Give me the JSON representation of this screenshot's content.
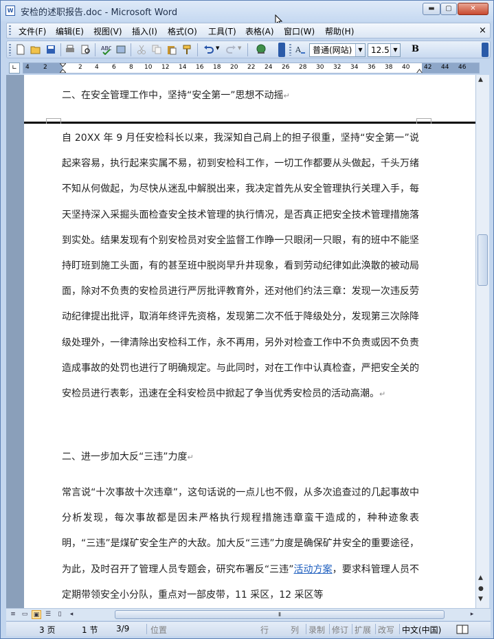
{
  "window": {
    "title": "安检的述职报告.doc - Microsoft Word",
    "app_icon_text": "W",
    "min_glyph": "▬",
    "max_glyph": "▢",
    "close_glyph": "✕"
  },
  "menu": {
    "items": [
      "文件(F)",
      "编辑(E)",
      "视图(V)",
      "插入(I)",
      "格式(O)",
      "工具(T)",
      "表格(A)",
      "窗口(W)",
      "帮助(H)"
    ],
    "close_glyph": "×"
  },
  "toolbar": {
    "style_value": "普通(网站)",
    "size_value": "12.5",
    "bold_label": "B"
  },
  "ruler": {
    "corner_glyph": "∟",
    "labels": [
      "4",
      "2",
      "2",
      "4",
      "6",
      "8",
      "10",
      "12",
      "14",
      "16",
      "18",
      "20",
      "22",
      "24",
      "26",
      "28",
      "30",
      "32",
      "34",
      "36",
      "38",
      "40",
      "42",
      "44",
      "46"
    ]
  },
  "document": {
    "heading1": "二、在安全管理工作中，坚持“安全第一”思想不动摇",
    "para1": "自 20XX 年 9 月任安检科长以来，我深知自己肩上的担子很重，坚持“安全第一”说起来容易，执行起来实属不易，初到安检科工作，一切工作都要从头做起，千头万绪不知从何做起，为尽快从迷乱中解脱出来，我决定首先从安全管理执行关理入手，每天坚持深入采掘头面检查安全技术管理的执行情况，是否真正把安全技术管理措施落到实处。结果发现有个别安检员对安全监督工作睁一只眼闭一只眼，有的班中不能坚持盯班到施工头面，有的甚至班中脱岗早升井现象，看到劳动纪律如此涣散的被动局面，除对不负责的安检员进行严厉批评教育外，还对他们约法三章：发现一次违反劳动纪律提出批评，取消年终评先资格，发现第二次不低于降级处分，发现第三次除降级处理外，一律清除出安检科工作，永不再用，另外对检查工作中不负责或因不负责造成事故的处罚也进行了明确规定。与此同时，对在工作中认真检查，严把安全关的安检员进行表彰，迅速在全科安检员中掀起了争当优秀安检员的活动高潮。",
    "heading2": "二、进一步加大反“三违”力度",
    "para2_start": "常言说“十次事故十次违章”，这句话说的一点儿也不假，从多次追查过的几起事故中分析发现，每次事故都是因未严格执行规程措施违章蛮干造成的，种种迹象表明，“三违”是煤矿安全生产的大敌。加大反“三违”力度是确保矿井安全的重要途径，为此，及时召开了管理人员专题会，研究布署反“三违”",
    "para2_link": "活动方案",
    "para2_end": "，要求科管理人员不定期带领安全小分队，重点对一部皮带，11 采区，12 采区等",
    "para_mark": "↵"
  },
  "scroll": {
    "h_thumb_glyph": "⦀",
    "up": "▲",
    "down": "▼",
    "left": "◂",
    "right": "▸"
  },
  "status": {
    "page": "3 页",
    "section": "1 节",
    "page_of": "3/9",
    "position": "位置",
    "line": "行",
    "col": "列",
    "rec": "录制",
    "trk": "修订",
    "ext": "扩展",
    "ovr": "改写",
    "language": "中文(中国)"
  }
}
